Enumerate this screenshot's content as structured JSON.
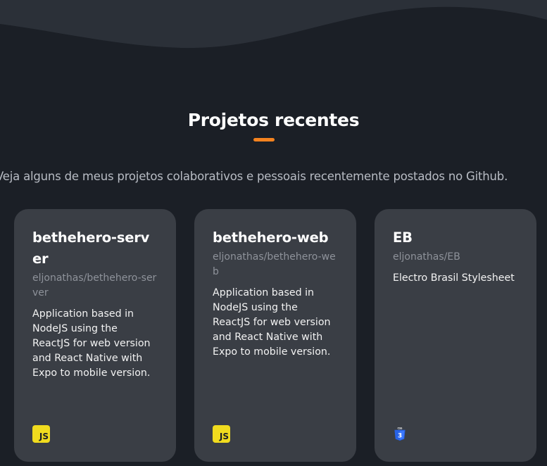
{
  "section": {
    "title": "Projetos recentes",
    "subtitle": "Veja alguns de meus projetos colaborativos e pessoais recentemente postados no Github."
  },
  "projects": [
    {
      "name": "bethehero-server",
      "repo": "eljonathas/bethehero-server",
      "description": "Application based in NodeJS using the ReactJS for web version and React Native with Expo to mobile version.",
      "language_icon": "javascript-icon",
      "language_label": "JS"
    },
    {
      "name": "bethehero-web",
      "repo": "eljonathas/bethehero-web",
      "description": "Application based in NodeJS using the ReactJS for web version and React Native with Expo to mobile version.",
      "language_icon": "javascript-icon",
      "language_label": "JS"
    },
    {
      "name": "EB",
      "repo": "eljonathas/EB",
      "description": "Electro Brasil Stylesheet",
      "language_icon": "css3-icon",
      "language_label": "CSS"
    }
  ],
  "colors": {
    "background": "#1b1f26",
    "wave": "#2b3038",
    "card": "#3a3e45",
    "accent": "#f5831f",
    "js_yellow": "#f0db1e",
    "css_blue": "#2763e8"
  }
}
